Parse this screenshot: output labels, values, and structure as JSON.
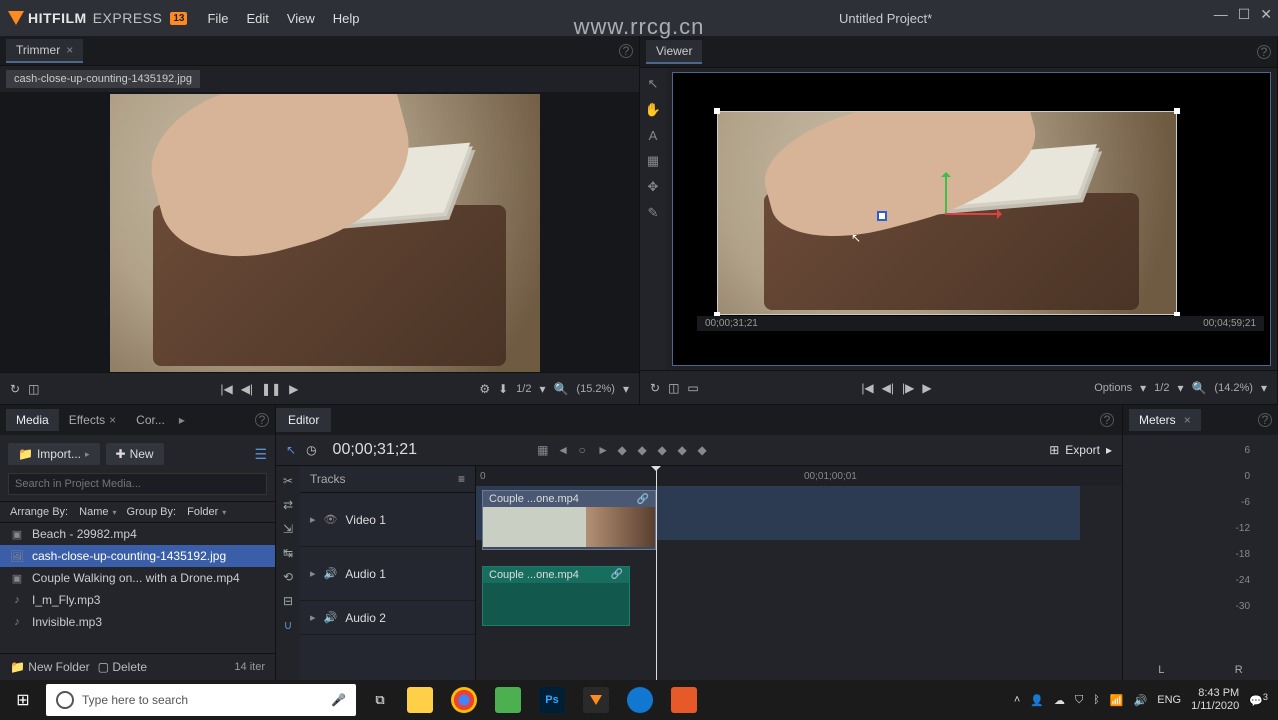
{
  "app_brand": {
    "name1": "HITFILM",
    "name2": "EXPRESS",
    "ver": "13"
  },
  "menu": {
    "file": "File",
    "edit": "Edit",
    "view": "View",
    "help": "Help"
  },
  "project_title": "Untitled Project*",
  "watermark": "www.rrcg.cn",
  "trimmer": {
    "tab": "Trimmer",
    "clip": "cash-close-up-counting-1435192.jpg",
    "zoom": "(15.2%)",
    "ratio": "1/2"
  },
  "viewer": {
    "tab": "Viewer",
    "tc_start": "00;00;31;21",
    "tc_end": "00;04;59;21",
    "options": "Options",
    "ratio": "1/2",
    "zoom": "(14.2%)"
  },
  "media": {
    "tabs": {
      "media": "Media",
      "effects": "Effects",
      "cor": "Cor..."
    },
    "import": "Import...",
    "new": "New",
    "search_ph": "Search in Project Media...",
    "arrange_label": "Arrange By:",
    "arrange_val": "Name",
    "group_label": "Group By:",
    "group_val": "Folder",
    "items": [
      {
        "type": "video",
        "name": "Beach - 29982.mp4"
      },
      {
        "type": "image",
        "name": "cash-close-up-counting-1435192.jpg",
        "selected": true
      },
      {
        "type": "video",
        "name": "Couple Walking on... with a Drone.mp4"
      },
      {
        "type": "audio",
        "name": "I_m_Fly.mp3"
      },
      {
        "type": "audio",
        "name": "Invisible.mp3"
      }
    ],
    "new_folder": "New Folder",
    "delete": "Delete",
    "count": "14 iter"
  },
  "editor": {
    "tab": "Editor",
    "timecode": "00;00;31;21",
    "tracks_label": "Tracks",
    "tracks": {
      "v1": "Video 1",
      "a1": "Audio 1",
      "a2": "Audio 2"
    },
    "ruler": {
      "t0": "0",
      "t1": "00;01;00;01"
    },
    "clip_v": "Couple ...one.mp4",
    "clip_a": "Couple ...one.mp4",
    "export": "Export"
  },
  "meters": {
    "tab": "Meters",
    "scale": [
      "6",
      "0",
      "-6",
      "-12",
      "-18",
      "-24",
      "-30"
    ],
    "left": "L",
    "right": "R"
  },
  "taskbar": {
    "search_ph": "Type here to search",
    "lang": "ENG",
    "time": "8:43 PM",
    "date": "1/11/2020",
    "notif": "3"
  }
}
